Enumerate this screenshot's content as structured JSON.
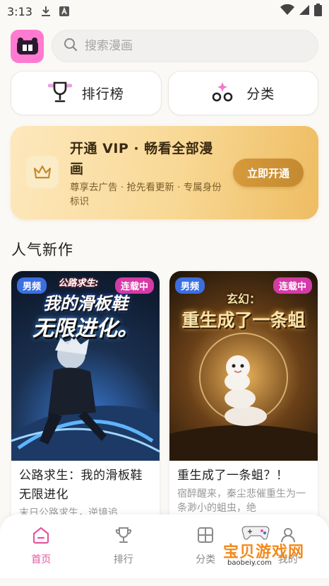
{
  "status_bar": {
    "time": "3:13"
  },
  "search": {
    "placeholder": "搜索漫画"
  },
  "entries": [
    {
      "label": "排行榜",
      "icon": "trophy-icon"
    },
    {
      "label": "分类",
      "icon": "category-bubbles-icon"
    }
  ],
  "vip": {
    "title": "开通 VIP · 畅看全部漫画",
    "subtitle": "尊享去广告 · 抢先看更新 · 专属身份标识",
    "button": "立即开通",
    "icon": "crown-icon"
  },
  "section": {
    "title": "人气新作"
  },
  "cards": [
    {
      "tag_left": "男频",
      "tag_right": "连载中",
      "cover_line1": "公路求生:",
      "cover_line2": "我的滑板鞋",
      "cover_line3": "无限进化。",
      "title": "公路求生：我的滑板鞋无限进化",
      "desc": "末日公路求生，逆境追"
    },
    {
      "tag_left": "男频",
      "tag_right": "连载中",
      "cover_line1": "玄幻：",
      "cover_line2": "重生成了一条蛆",
      "title": "重生成了一条蛆？！",
      "desc": "宿醉醒来，秦尘悲催重生为一条渺小的蛆虫，绝"
    }
  ],
  "bottom_nav": [
    {
      "label": "首页",
      "icon": "home-icon",
      "active": true
    },
    {
      "label": "排行",
      "icon": "trophy-outline-icon",
      "active": false
    },
    {
      "label": "分类",
      "icon": "grid-icon",
      "active": false
    },
    {
      "label": "我的",
      "icon": "user-icon",
      "active": false
    }
  ],
  "watermark": {
    "text": "宝贝游戏网",
    "url": "baobeiy.com"
  },
  "colors": {
    "accent": "#e8559f",
    "vip_button": "#d79a3c",
    "tag_blue": "#3b6ee0",
    "tag_pink": "#d63aa6"
  }
}
